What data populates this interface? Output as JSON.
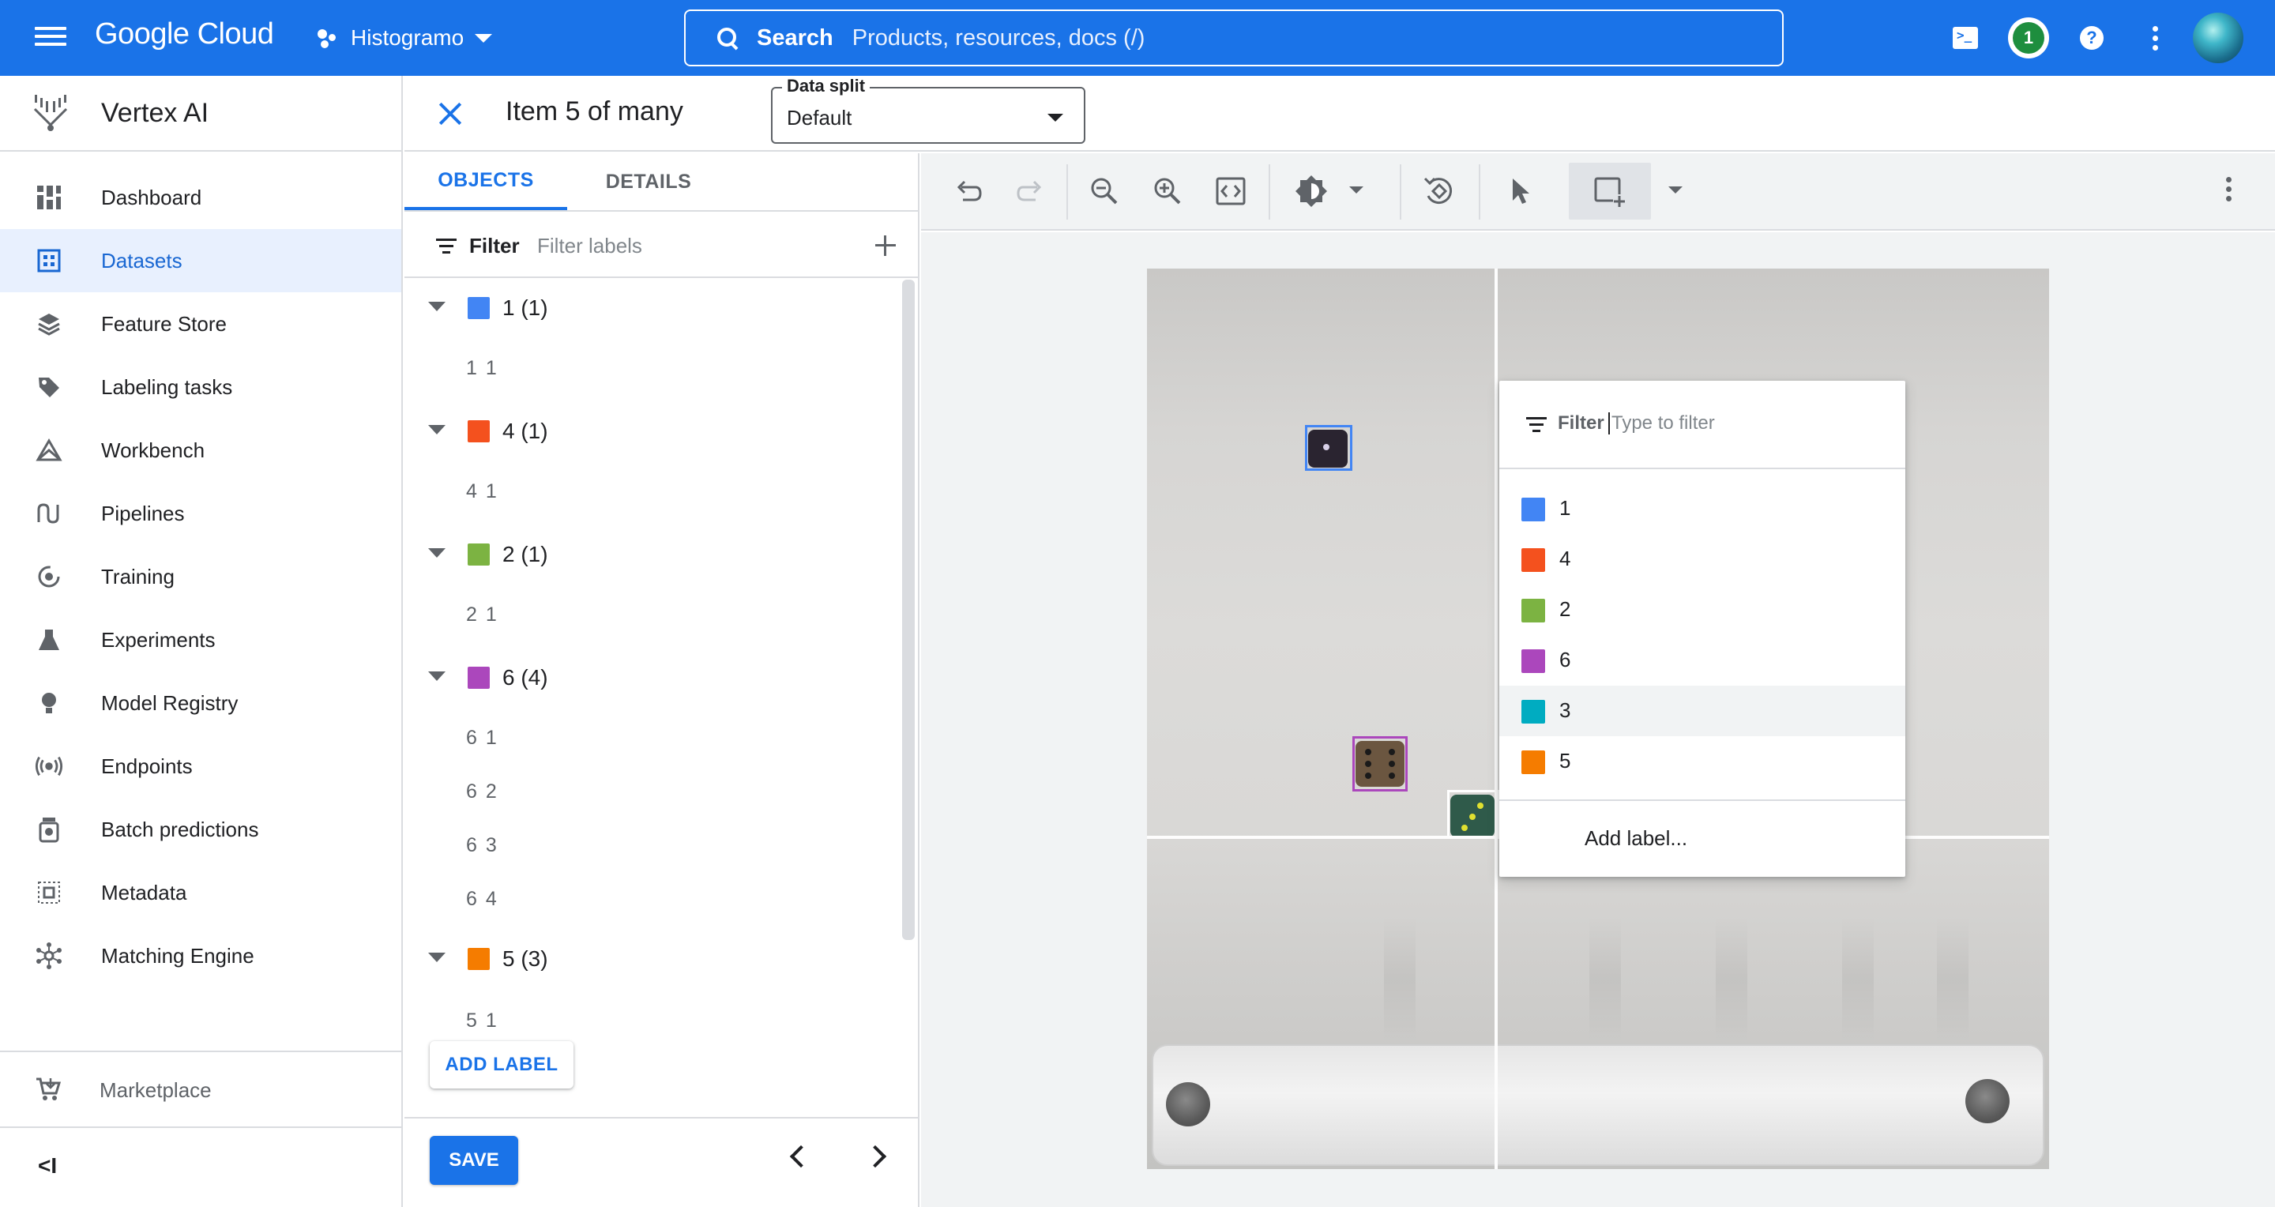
{
  "topbar": {
    "brand": "Google Cloud",
    "project": "Histogramo",
    "search_label": "Search",
    "search_placeholder": "Products, resources, docs (/)",
    "notification_count": "1"
  },
  "sidebar": {
    "product": "Vertex AI",
    "items": [
      {
        "label": "Dashboard",
        "icon": "dashboard-icon"
      },
      {
        "label": "Datasets",
        "icon": "datasets-icon",
        "active": true
      },
      {
        "label": "Feature Store",
        "icon": "feature-store-icon"
      },
      {
        "label": "Labeling tasks",
        "icon": "tag-icon"
      },
      {
        "label": "Workbench",
        "icon": "workbench-icon"
      },
      {
        "label": "Pipelines",
        "icon": "pipelines-icon"
      },
      {
        "label": "Training",
        "icon": "training-icon"
      },
      {
        "label": "Experiments",
        "icon": "flask-icon"
      },
      {
        "label": "Model Registry",
        "icon": "lightbulb-icon"
      },
      {
        "label": "Endpoints",
        "icon": "broadcast-icon"
      },
      {
        "label": "Batch predictions",
        "icon": "batch-icon"
      },
      {
        "label": "Metadata",
        "icon": "metadata-icon"
      },
      {
        "label": "Matching Engine",
        "icon": "hub-icon"
      }
    ],
    "marketplace": "Marketplace",
    "collapse_label": "<I"
  },
  "header": {
    "title": "Item 5 of many",
    "data_split_label": "Data split",
    "data_split_value": "Default"
  },
  "panel": {
    "tabs": [
      "OBJECTS",
      "DETAILS"
    ],
    "filter_label": "Filter",
    "filter_placeholder": "Filter labels",
    "groups": [
      {
        "label": "1 (1)",
        "color": "#4285f4",
        "instances": [
          "1 1"
        ]
      },
      {
        "label": "4 (1)",
        "color": "#f4511e",
        "instances": [
          "4 1"
        ]
      },
      {
        "label": "2 (1)",
        "color": "#7cb342",
        "instances": [
          "2 1"
        ]
      },
      {
        "label": "6 (4)",
        "color": "#ab47bc",
        "instances": [
          "6 1",
          "6 2",
          "6 3",
          "6 4"
        ]
      },
      {
        "label": "5 (3)",
        "color": "#f57c00",
        "instances": [
          "5 1"
        ]
      }
    ],
    "add_label": "ADD LABEL",
    "save_label": "SAVE"
  },
  "popup": {
    "filter_label": "Filter",
    "filter_placeholder": "Type to filter",
    "options": [
      {
        "label": "1",
        "color": "#4285f4"
      },
      {
        "label": "4",
        "color": "#f4511e"
      },
      {
        "label": "2",
        "color": "#7cb342"
      },
      {
        "label": "6",
        "color": "#ab47bc"
      },
      {
        "label": "3",
        "color": "#00acc1",
        "hover": true
      },
      {
        "label": "5",
        "color": "#f57c00"
      }
    ],
    "add_label": "Add label..."
  },
  "colors": {
    "accent": "#1a73e8",
    "topbar": "#1a73e8",
    "active_nav_bg": "#e8f0fe"
  }
}
